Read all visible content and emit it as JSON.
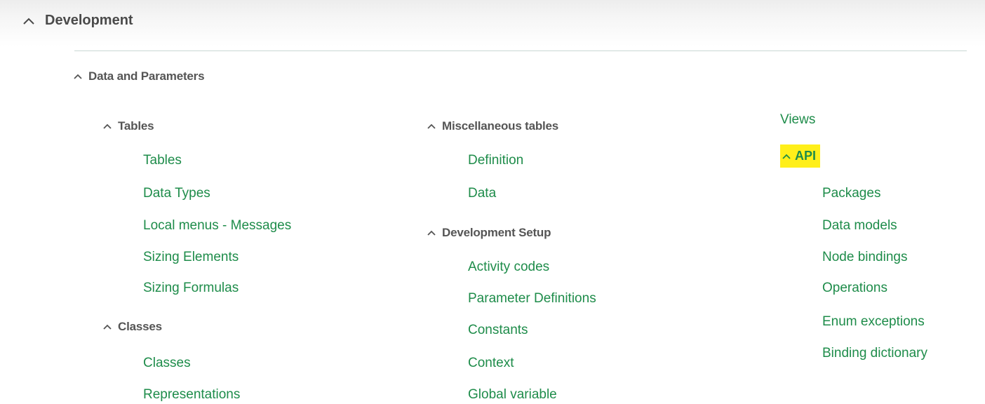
{
  "section": {
    "title": "Development"
  },
  "subsection": {
    "title": "Data and Parameters"
  },
  "col1": {
    "tables": {
      "title": "Tables",
      "items": [
        "Tables",
        "Data Types",
        "Local menus - Messages",
        "Sizing Elements",
        "Sizing Formulas"
      ]
    },
    "classes": {
      "title": "Classes",
      "items": [
        "Classes",
        "Representations"
      ]
    }
  },
  "col2": {
    "misc": {
      "title": "Miscellaneous tables",
      "items": [
        "Definition",
        "Data"
      ]
    },
    "setup": {
      "title": "Development Setup",
      "items": [
        "Activity codes",
        "Parameter Definitions",
        "Constants",
        "Context",
        "Global variable"
      ]
    }
  },
  "col3": {
    "views_label": "Views",
    "api": {
      "title": "API",
      "items": [
        "Packages",
        "Data models",
        "Node bindings",
        "Operations",
        "Enum exceptions",
        "Binding dictionary"
      ]
    }
  },
  "colors": {
    "link": "#1e8c4a",
    "heading": "#555555",
    "highlight": "#ffef1a"
  },
  "icons": {
    "collapse": "chevron-up-icon"
  }
}
